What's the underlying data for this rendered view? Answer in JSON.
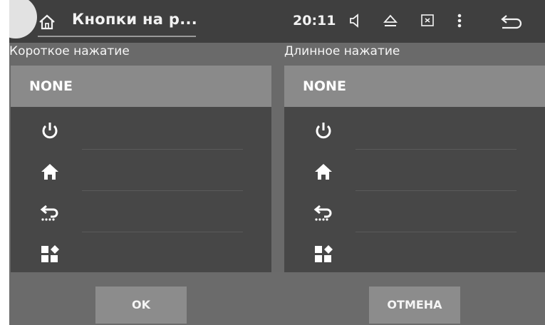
{
  "topbar": {
    "title": "Кнопки на р...",
    "time": "20:11",
    "icons": [
      "home-icon",
      "volume-icon",
      "eject-icon",
      "screen-off-icon",
      "menu-dots-icon",
      "back-icon"
    ]
  },
  "short_press": {
    "label": "Короткое нажатие",
    "selected": "NONE",
    "options": [
      "NONE",
      "power-icon",
      "home-icon",
      "back-icon",
      "apps-icon"
    ]
  },
  "long_press": {
    "label": "Длинное нажатие",
    "selected": "NONE",
    "options": [
      "NONE",
      "power-icon",
      "home-icon",
      "back-icon",
      "apps-icon"
    ]
  },
  "buttons": {
    "ok": "OK",
    "cancel": "ОТМЕНА"
  },
  "colors": {
    "topbar": "#3f3f3f",
    "panel": "#474747",
    "selected_row": "#8a8a8a",
    "button": "#8c8c8c",
    "text": "#f5f5f5"
  }
}
